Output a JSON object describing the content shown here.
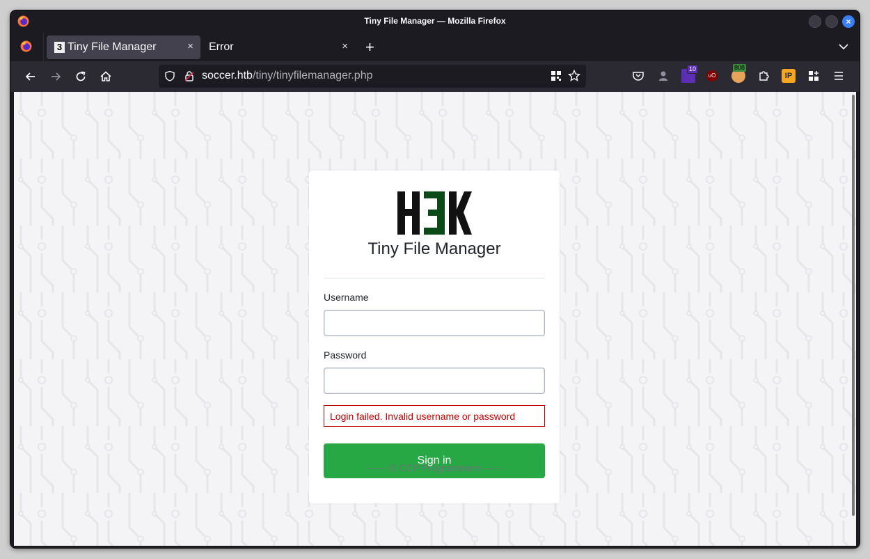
{
  "window": {
    "title": "Tiny File Manager — Mozilla Firefox"
  },
  "tabs": [
    {
      "label": "Tiny File Manager",
      "favicon": "3",
      "active": true
    },
    {
      "label": "Error",
      "active": false
    }
  ],
  "tab_controls": {
    "close_glyph": "×",
    "new_tab_glyph": "+",
    "list_glyph": "⌄"
  },
  "urlbar": {
    "host": "soccer.htb",
    "path": "/tiny/tinyfilemanager.php"
  },
  "extensions": [
    {
      "name": "pocket-icon"
    },
    {
      "name": "extension-icon"
    },
    {
      "name": "adblock-icon",
      "badge": "10"
    },
    {
      "name": "ublock-icon",
      "text": "uO"
    },
    {
      "name": "avatar-extension-icon",
      "badge": "808"
    },
    {
      "name": "puzzle-icon"
    },
    {
      "name": "ip-extension-icon",
      "text": "IP"
    },
    {
      "name": "grid-plus-icon"
    },
    {
      "name": "menu-icon"
    }
  ],
  "login": {
    "logo_text": "H3K",
    "app_name": "Tiny File Manager",
    "username_label": "Username",
    "username_value": "",
    "password_label": "Password",
    "password_value": "",
    "error_message": "Login failed. Invalid username or password",
    "signin_label": "Sign in"
  },
  "footer": {
    "text": "—— © CCP Programmers ——"
  },
  "colors": {
    "signin_bg": "#28a745",
    "error": "#c00000",
    "logo_black": "#111111",
    "logo_green": "#0b4a16"
  }
}
